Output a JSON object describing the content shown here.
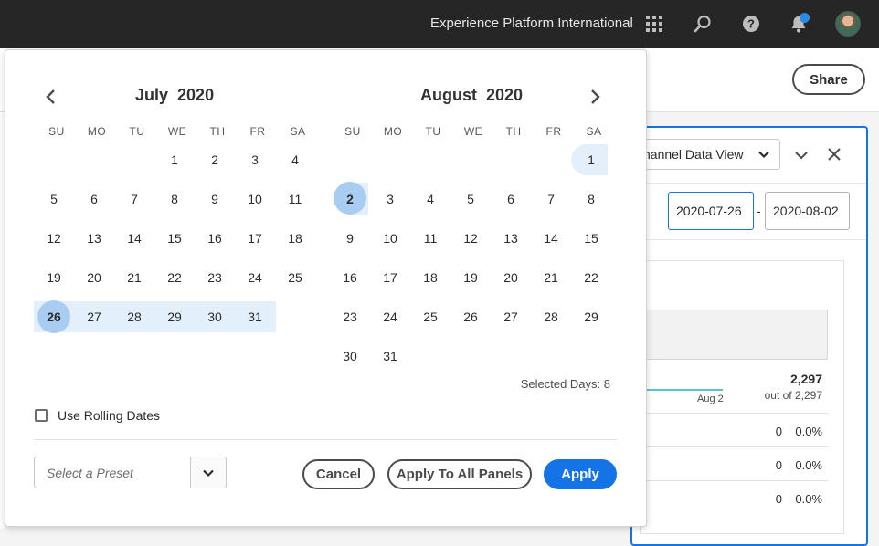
{
  "topbar": {
    "org_name": "Experience Platform International",
    "icons": [
      "apps-grid-icon",
      "search-icon",
      "help-icon",
      "bell-icon",
      "avatar"
    ]
  },
  "background": {
    "share_label": "Share",
    "data_view_label": "hannel Data View",
    "start_date": "2020-07-26",
    "end_date": "2020-08-02",
    "date_separator": "-",
    "metric_total": "2,297",
    "metric_sub": "out of 2,297",
    "spark_label": "Aug 2",
    "rows": [
      {
        "value": "0",
        "percent": "0.0%"
      },
      {
        "value": "0",
        "percent": "0.0%"
      },
      {
        "value": "0",
        "percent": "0.0%"
      }
    ]
  },
  "picker": {
    "left": {
      "month": "July",
      "year": "2020"
    },
    "right": {
      "month": "August",
      "year": "2020"
    },
    "weekdays": [
      "SU",
      "MO",
      "TU",
      "WE",
      "TH",
      "FR",
      "SA"
    ],
    "selected_days": "Selected Days: 8",
    "rolling_label": "Use Rolling Dates",
    "preset_placeholder": "Select a Preset",
    "cancel": "Cancel",
    "apply_all": "Apply To All Panels",
    "apply": "Apply",
    "accent_color": "#1473e6",
    "range_color": "#e4effc",
    "endpoint_color": "#a9ccf2"
  }
}
